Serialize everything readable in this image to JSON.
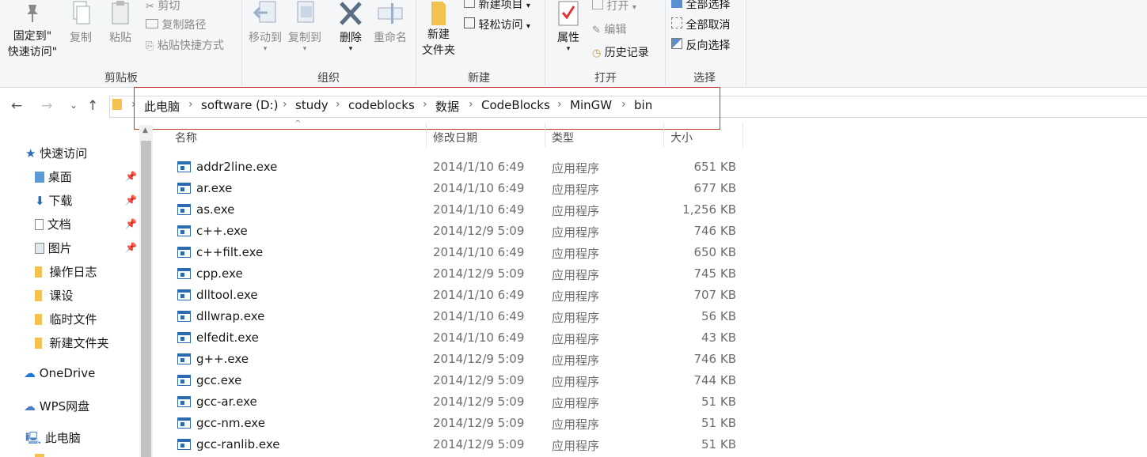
{
  "ribbon": {
    "clipboard": {
      "group_label": "剪贴板",
      "pin_quick_access_line1": "固定到\"",
      "pin_quick_access_line2": "快速访问\"",
      "copy": "复制",
      "paste": "粘贴",
      "cut": "剪切",
      "copy_path": "复制路径",
      "paste_shortcut": "粘贴快捷方式"
    },
    "organize": {
      "group_label": "组织",
      "move_to": "移动到",
      "copy_to": "复制到",
      "delete": "删除",
      "rename": "重命名"
    },
    "new": {
      "group_label": "新建",
      "new_folder_line1": "新建",
      "new_folder_line2": "文件夹",
      "new_item": "新建项目",
      "easy_access": "轻松访问"
    },
    "open": {
      "group_label": "打开",
      "properties": "属性",
      "open": "打开",
      "edit": "编辑",
      "history": "历史记录"
    },
    "select": {
      "group_label": "选择",
      "select_all": "全部选择",
      "select_none": "全部取消",
      "invert": "反向选择"
    }
  },
  "address": {
    "crumbs": [
      "此电脑",
      "software (D:)",
      "study",
      "codeblocks",
      "数据",
      "CodeBlocks",
      "MinGW",
      "bin"
    ]
  },
  "nav_pane": {
    "quick_access": "快速访问",
    "items": [
      {
        "label": "桌面",
        "pinned": true
      },
      {
        "label": "下载",
        "pinned": true
      },
      {
        "label": "文档",
        "pinned": true
      },
      {
        "label": "图片",
        "pinned": true
      },
      {
        "label": "操作日志",
        "pinned": false
      },
      {
        "label": "课设",
        "pinned": false
      },
      {
        "label": "临时文件",
        "pinned": false
      },
      {
        "label": "新建文件夹",
        "pinned": false
      }
    ],
    "onedrive": "OneDrive",
    "wps": "WPS网盘",
    "this_pc": "此电脑"
  },
  "file_list": {
    "columns": {
      "name": "名称",
      "date": "修改日期",
      "type": "类型",
      "size": "大小"
    },
    "rows": [
      {
        "name": "addr2line.exe",
        "date": "2014/1/10 6:49",
        "type": "应用程序",
        "size": "651 KB"
      },
      {
        "name": "ar.exe",
        "date": "2014/1/10 6:49",
        "type": "应用程序",
        "size": "677 KB"
      },
      {
        "name": "as.exe",
        "date": "2014/1/10 6:49",
        "type": "应用程序",
        "size": "1,256 KB"
      },
      {
        "name": "c++.exe",
        "date": "2014/12/9 5:09",
        "type": "应用程序",
        "size": "746 KB"
      },
      {
        "name": "c++filt.exe",
        "date": "2014/1/10 6:49",
        "type": "应用程序",
        "size": "650 KB"
      },
      {
        "name": "cpp.exe",
        "date": "2014/12/9 5:09",
        "type": "应用程序",
        "size": "745 KB"
      },
      {
        "name": "dlltool.exe",
        "date": "2014/1/10 6:49",
        "type": "应用程序",
        "size": "707 KB"
      },
      {
        "name": "dllwrap.exe",
        "date": "2014/1/10 6:49",
        "type": "应用程序",
        "size": "56 KB"
      },
      {
        "name": "elfedit.exe",
        "date": "2014/1/10 6:49",
        "type": "应用程序",
        "size": "43 KB"
      },
      {
        "name": "g++.exe",
        "date": "2014/12/9 5:09",
        "type": "应用程序",
        "size": "746 KB"
      },
      {
        "name": "gcc.exe",
        "date": "2014/12/9 5:09",
        "type": "应用程序",
        "size": "744 KB"
      },
      {
        "name": "gcc-ar.exe",
        "date": "2014/12/9 5:09",
        "type": "应用程序",
        "size": "51 KB"
      },
      {
        "name": "gcc-nm.exe",
        "date": "2014/12/9 5:09",
        "type": "应用程序",
        "size": "51 KB"
      },
      {
        "name": "gcc-ranlib.exe",
        "date": "2014/12/9 5:09",
        "type": "应用程序",
        "size": "51 KB"
      }
    ]
  },
  "colors": {
    "highlight_box": "#c0392b",
    "exe_icon": "#2b6cb0",
    "folder": "#f2c14e"
  }
}
